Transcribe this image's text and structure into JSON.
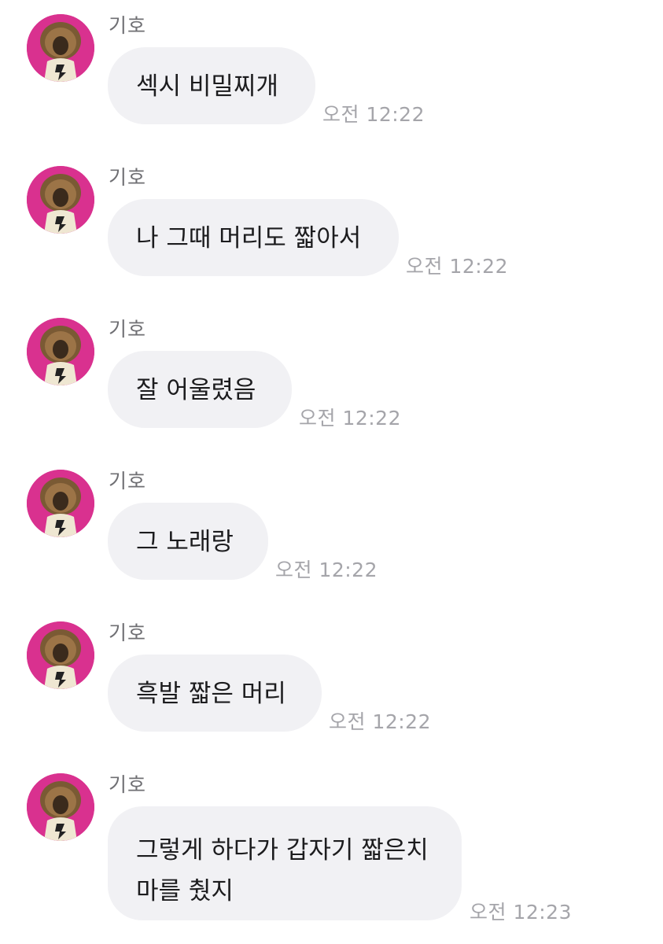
{
  "messages": [
    {
      "sender": "기호",
      "lines": [
        "섹시 비밀찌개"
      ],
      "time": "오전 12:22"
    },
    {
      "sender": "기호",
      "lines": [
        "나 그때 머리도 짧아서"
      ],
      "time": "오전 12:22"
    },
    {
      "sender": "기호",
      "lines": [
        "잘 어울렸음"
      ],
      "time": "오전 12:22"
    },
    {
      "sender": "기호",
      "lines": [
        "그 노래랑"
      ],
      "time": "오전 12:22"
    },
    {
      "sender": "기호",
      "lines": [
        "흑발 짧은 머리"
      ],
      "time": "오전 12:22"
    },
    {
      "sender": "기호",
      "lines": [
        "그렇게 하다가 갑자기 짧은치",
        "마를 췄지"
      ],
      "time": "오전 12:23"
    }
  ],
  "colors": {
    "bubble": "#f1f1f4",
    "avatar_bg": "#d9318f",
    "sender_text": "#6f6f73",
    "time_text": "#a5a5aa",
    "message_text": "#1c1c1e"
  },
  "icons": {
    "avatar": "profile-photo"
  }
}
